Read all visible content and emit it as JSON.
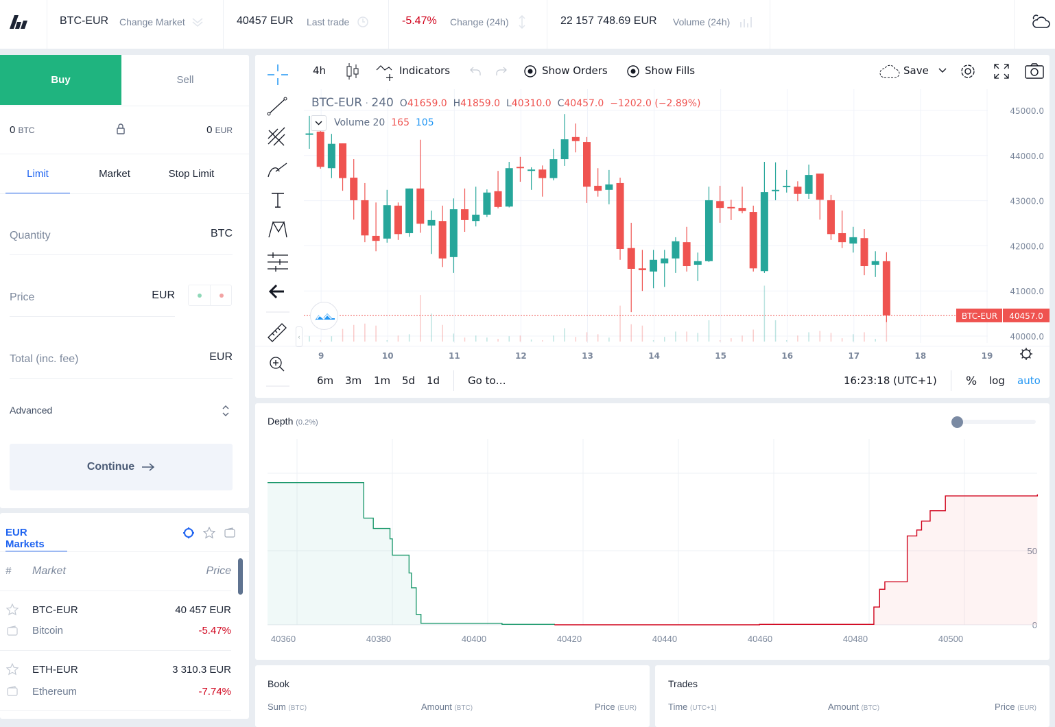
{
  "header": {
    "market": "BTC-EUR",
    "change_market": "Change Market",
    "last_trade_value": "40457 EUR",
    "last_trade_label": "Last trade",
    "change_value": "-5.47%",
    "change_label": "Change (24h)",
    "volume_value": "22 157 748.69 EUR",
    "volume_label": "Volume (24h)"
  },
  "order": {
    "tabs": [
      {
        "label": "Buy",
        "active": true
      },
      {
        "label": "Sell",
        "active": false
      }
    ],
    "balance_btc": "0",
    "balance_btc_unit": "BTC",
    "balance_eur": "0",
    "balance_eur_unit": "EUR",
    "types": [
      {
        "label": "Limit",
        "active": true
      },
      {
        "label": "Market"
      },
      {
        "label": "Stop Limit"
      }
    ],
    "quantity_label": "Quantity",
    "quantity_unit": "BTC",
    "price_label": "Price",
    "price_unit": "EUR",
    "total_label": "Total (inc. fee)",
    "total_unit": "EUR",
    "advanced_label": "Advanced",
    "continue_label": "Continue"
  },
  "markets": {
    "tab": "EUR Markets",
    "col_hash": "#",
    "col_market": "Market",
    "col_price": "Price",
    "rows": [
      {
        "symbol": "BTC-EUR",
        "name": "Bitcoin",
        "price": "40 457 EUR",
        "change": "-5.47%"
      },
      {
        "symbol": "ETH-EUR",
        "name": "Ethereum",
        "price": "3 310.3 EUR",
        "change": "-7.74%"
      }
    ]
  },
  "chart_toolbar": {
    "interval": "4h",
    "indicators": "Indicators",
    "show_orders": "Show Orders",
    "show_fills": "Show Fills",
    "save": "Save"
  },
  "chart_legend": {
    "symbol": "BTC-EUR",
    "sep": "·",
    "interval": "240",
    "o": "41659.0",
    "h": "41859.0",
    "l": "40310.0",
    "c": "40457.0",
    "change": "−1202.0 (−2.89%)",
    "volume_label": "Volume 20",
    "volume_value": "165",
    "volume_ma": "105"
  },
  "chart_bottom": {
    "ranges": [
      "6m",
      "3m",
      "1m",
      "5d",
      "1d"
    ],
    "goto": "Go to…",
    "time": "16:23:18 (UTC+1)",
    "percent": "%",
    "log": "log",
    "auto": "auto"
  },
  "colors": {
    "up": "#26a69a",
    "down": "#ef5350",
    "buy": "#1fb47f",
    "accent": "#1e63f0",
    "negative": "#d0021b"
  },
  "chart_data": [
    {
      "type": "candlestick",
      "title": "BTC-EUR · 240",
      "price_ticks": [
        "45000.0",
        "44000.0",
        "43000.0",
        "42000.0",
        "41000.0",
        "40000.0"
      ],
      "ylim": [
        40000,
        45000
      ],
      "x_ticks": [
        "9",
        "10",
        "11",
        "12",
        "13",
        "14",
        "15",
        "16",
        "17",
        "18",
        "19"
      ],
      "last_price_label": "BTC-EUR",
      "last_price": "40457.0",
      "last_price_value": 40457,
      "ohlc": [
        [
          44470,
          44880,
          44150,
          44490
        ],
        [
          44530,
          44560,
          43710,
          43750
        ],
        [
          43720,
          44480,
          43500,
          44260
        ],
        [
          44270,
          44270,
          43220,
          43500
        ],
        [
          43510,
          43920,
          42580,
          43010
        ],
        [
          43010,
          43390,
          42080,
          42230
        ],
        [
          42220,
          42960,
          41880,
          42110
        ],
        [
          42160,
          43240,
          42070,
          42900
        ],
        [
          42890,
          42960,
          42130,
          42260
        ],
        [
          42280,
          43270,
          42200,
          43270
        ],
        [
          43270,
          44350,
          42290,
          42490
        ],
        [
          42450,
          42780,
          41820,
          42570
        ],
        [
          42550,
          42890,
          41530,
          41720
        ],
        [
          41750,
          43050,
          41400,
          42810
        ],
        [
          42810,
          43270,
          42310,
          42570
        ],
        [
          42550,
          43310,
          42430,
          42690
        ],
        [
          42690,
          43250,
          42640,
          43180
        ],
        [
          43210,
          43660,
          42830,
          42860
        ],
        [
          42870,
          43860,
          42850,
          43720
        ],
        [
          43750,
          43970,
          43420,
          43720
        ],
        [
          43660,
          43740,
          43240,
          43690
        ],
        [
          43690,
          43780,
          43090,
          43500
        ],
        [
          43500,
          44150,
          43450,
          43920
        ],
        [
          43920,
          44920,
          43770,
          44360
        ],
        [
          44410,
          44710,
          44070,
          44320
        ],
        [
          44300,
          44410,
          42950,
          43310
        ],
        [
          43330,
          43720,
          43090,
          43220
        ],
        [
          43240,
          43680,
          42920,
          43360
        ],
        [
          43390,
          43510,
          41690,
          41930
        ],
        [
          41950,
          42510,
          40530,
          41490
        ],
        [
          41500,
          41910,
          41000,
          41460
        ],
        [
          41430,
          41910,
          41060,
          41690
        ],
        [
          41610,
          41910,
          41090,
          41720
        ],
        [
          41720,
          42190,
          41400,
          42100
        ],
        [
          42080,
          42420,
          41430,
          41550
        ],
        [
          41580,
          41850,
          41220,
          41660
        ],
        [
          41660,
          43310,
          41640,
          43010
        ],
        [
          42990,
          43330,
          42510,
          42840
        ],
        [
          42860,
          43020,
          42570,
          42830
        ],
        [
          42840,
          43310,
          42720,
          42770
        ],
        [
          42750,
          42890,
          41430,
          41500
        ],
        [
          41440,
          43860,
          41400,
          43190
        ],
        [
          43220,
          43850,
          43010,
          43240
        ],
        [
          43300,
          43680,
          43180,
          43330
        ],
        [
          43310,
          43430,
          42990,
          43150
        ],
        [
          43150,
          43800,
          43040,
          43570
        ],
        [
          43600,
          43570,
          42580,
          43020
        ],
        [
          43010,
          43130,
          42130,
          42260
        ],
        [
          42280,
          42780,
          41950,
          42080
        ],
        [
          42050,
          42420,
          41850,
          42190
        ],
        [
          42170,
          42370,
          41350,
          41550
        ],
        [
          41580,
          41880,
          41310,
          41660
        ],
        [
          41659,
          41859,
          40310,
          40457
        ]
      ],
      "volume": [
        40,
        10,
        40,
        95,
        125,
        135,
        120,
        10,
        45,
        55,
        350,
        210,
        125,
        60,
        30,
        45,
        30,
        20,
        40,
        45,
        15,
        10,
        45,
        100,
        35,
        70,
        55,
        30,
        270,
        130,
        120,
        10,
        35,
        75,
        75,
        65,
        160,
        10,
        25,
        45,
        90,
        420,
        160,
        10,
        45,
        70,
        80,
        65,
        25,
        55,
        70,
        20,
        165
      ]
    },
    {
      "type": "area",
      "title": "Depth",
      "subtitle": "(0.2%)",
      "x_ticks": [
        "40360",
        "40380",
        "40400",
        "40420",
        "40440",
        "40460",
        "40480",
        "40500"
      ],
      "y_ticks": [
        "0",
        "50"
      ],
      "bids": [
        [
          40354,
          96
        ],
        [
          40374,
          72
        ],
        [
          40376,
          65
        ],
        [
          40379.5,
          58
        ],
        [
          40380,
          47
        ],
        [
          40383.5,
          35
        ],
        [
          40384,
          25
        ],
        [
          40385,
          7
        ],
        [
          40386,
          1
        ],
        [
          40403,
          0.3
        ],
        [
          40414,
          0
        ]
      ],
      "asks": [
        [
          40414,
          0
        ],
        [
          40457,
          0.3
        ],
        [
          40481,
          12
        ],
        [
          40482.2,
          24
        ],
        [
          40483.3,
          29
        ],
        [
          40488,
          60
        ],
        [
          40490,
          64
        ],
        [
          40491,
          70
        ],
        [
          40492.8,
          77
        ],
        [
          40496,
          87
        ],
        [
          40515.3,
          88
        ]
      ]
    }
  ],
  "book": {
    "title": "Book",
    "sum": "Sum",
    "sum_unit": "(BTC)",
    "amount": "Amount",
    "amount_unit": "(BTC)",
    "price": "Price",
    "price_unit": "(EUR)"
  },
  "trades": {
    "title": "Trades",
    "time": "Time",
    "time_unit": "(UTC+1)",
    "amount": "Amount",
    "amount_unit": "(BTC)",
    "price": "Price",
    "price_unit": "(EUR)"
  }
}
